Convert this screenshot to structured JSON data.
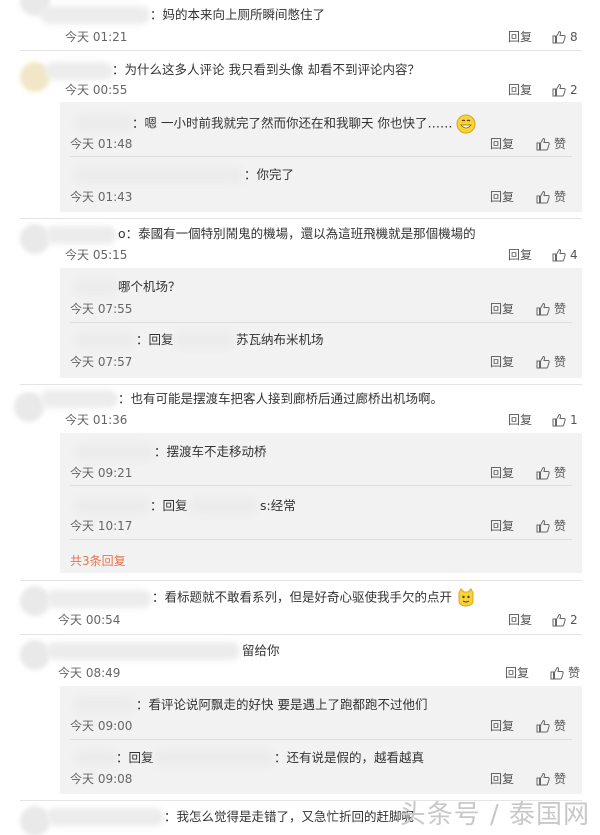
{
  "labels": {
    "reply": "回复",
    "like": "赞"
  },
  "c1": {
    "text": "：妈的本来向上厕所瞬间憋住了",
    "time": "今天 01:21",
    "likes": "8"
  },
  "c2": {
    "text": "：为什么这多人评论 我只看到头像 却看不到评论内容？",
    "time": "今天 00:55",
    "likes": "2",
    "replies": [
      {
        "text": "：嗯 一小时前我就完了然而你还在和我聊天 你也快了……",
        "time": "今天 01:48"
      },
      {
        "text": "：你完了",
        "time": "今天 01:43"
      }
    ]
  },
  "c3": {
    "text": "o：泰國有一個特別鬧鬼的機場，還以為這班飛機就是那個機場的",
    "time": "今天 05:15",
    "likes": "4",
    "replies": [
      {
        "text": "哪个机场？",
        "time": "今天 07:55"
      },
      {
        "prefix": "：回复",
        "text": "苏瓦纳布米机场",
        "time": "今天 07:57"
      }
    ]
  },
  "c4": {
    "text": "：也有可能是摆渡车把客人接到廊桥后通过廊桥出机场啊。",
    "time": "今天 01:36",
    "likes": "1",
    "replies": [
      {
        "text": "：摆渡车不走移动桥",
        "time": "今天 09:21"
      },
      {
        "prefix": "：回复",
        "text": "s:经常",
        "time": "今天 10:17"
      }
    ],
    "more": "共3条回复"
  },
  "c5": {
    "text": "：看标题就不敢看系列，但是好奇心驱使我手欠的点开",
    "time": "今天 00:54",
    "likes": "2"
  },
  "c6": {
    "text": "留给你",
    "time": "今天 08:49",
    "replies": [
      {
        "text": "：看评论说阿飘走的好快 要是遇上了跑都跑不过他们",
        "time": "今天 09:00"
      },
      {
        "prefix": "：回复",
        "text": "：还有说是假的，越看越真",
        "time": "今天 09:08"
      }
    ]
  },
  "c7": {
    "text": "：我怎么觉得是走错了，又急忙折回的赶脚呢"
  },
  "watermark": "头条号 / 泰国网",
  "colors": {
    "more": "#eb7350",
    "reply_bg": "#f2f2f2"
  }
}
